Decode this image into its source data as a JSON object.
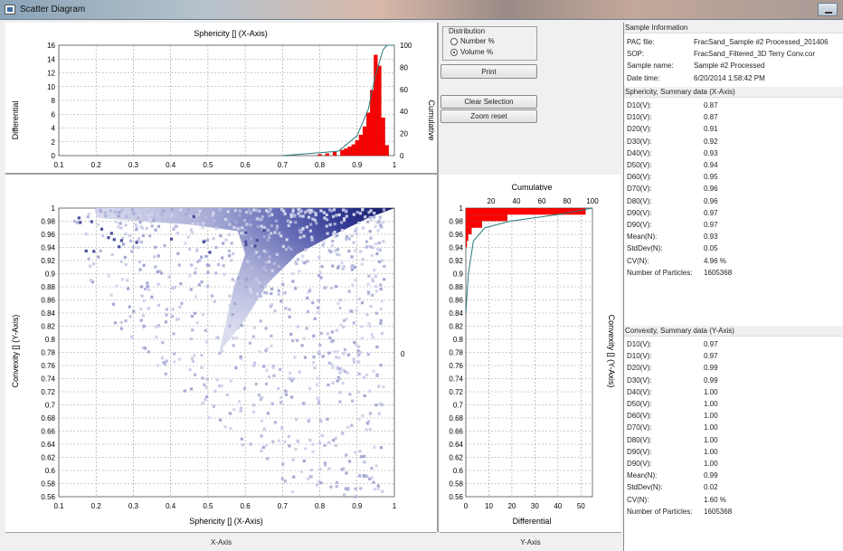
{
  "window": {
    "title": "Scatter Diagram",
    "icon": "app-icon"
  },
  "distribution": {
    "legend": "Distribution",
    "options": [
      "Number %",
      "Volume %"
    ],
    "selected": "Volume %"
  },
  "buttons": {
    "print": "Print",
    "clear_selection": "Clear Selection",
    "zoom_reset": "Zoom reset"
  },
  "footer": {
    "x_axis": "X-Axis",
    "y_axis": "Y-Axis"
  },
  "sample_info": {
    "header": "Sample Information",
    "rows": [
      {
        "k": "PAC file:",
        "v": "FracSand_Sample #2 Processed_201406"
      },
      {
        "k": "SOP:",
        "v": "FracSand_Filtered_3D Terry Conv.cor"
      },
      {
        "k": "Sample name:",
        "v": "Sample #2 Processed"
      },
      {
        "k": "Date time:",
        "v": "6/20/2014 1:58:42 PM"
      }
    ]
  },
  "sphericity_summary": {
    "header": "Sphericity, Summary data (X-Axis)",
    "rows": [
      {
        "k": "D10(V):",
        "v": "0.87"
      },
      {
        "k": "D10(V):",
        "v": "0.87"
      },
      {
        "k": "D20(V):",
        "v": "0.91"
      },
      {
        "k": "D30(V):",
        "v": "0.92"
      },
      {
        "k": "D40(V):",
        "v": "0.93"
      },
      {
        "k": "D50(V):",
        "v": "0.94"
      },
      {
        "k": "D60(V):",
        "v": "0.95"
      },
      {
        "k": "D70(V):",
        "v": "0.96"
      },
      {
        "k": "D80(V):",
        "v": "0.96"
      },
      {
        "k": "D90(V):",
        "v": "0.97"
      },
      {
        "k": "D90(V):",
        "v": "0.97"
      },
      {
        "k": "Mean(N):",
        "v": "0.93"
      },
      {
        "k": "StdDev(N):",
        "v": "0.05"
      },
      {
        "k": "CV(N):",
        "v": "4.96 %"
      },
      {
        "k": "Number of Particles:",
        "v": "1605368"
      }
    ]
  },
  "convexity_summary": {
    "header": "Convexity, Summary data (Y-Axis)",
    "rows": [
      {
        "k": "D10(V):",
        "v": "0.97"
      },
      {
        "k": "D10(V):",
        "v": "0.97"
      },
      {
        "k": "D20(V):",
        "v": "0.99"
      },
      {
        "k": "D30(V):",
        "v": "0.99"
      },
      {
        "k": "D40(V):",
        "v": "1.00"
      },
      {
        "k": "D50(V):",
        "v": "1.00"
      },
      {
        "k": "D60(V):",
        "v": "1.00"
      },
      {
        "k": "D70(V):",
        "v": "1.00"
      },
      {
        "k": "D80(V):",
        "v": "1.00"
      },
      {
        "k": "D90(V):",
        "v": "1.00"
      },
      {
        "k": "D90(V):",
        "v": "1.00"
      },
      {
        "k": "Mean(N):",
        "v": "0.99"
      },
      {
        "k": "StdDev(N):",
        "v": "0.02"
      },
      {
        "k": "CV(N):",
        "v": "1.60 %"
      },
      {
        "k": "Number of Particles:",
        "v": "1605368"
      }
    ]
  },
  "chart_data": [
    {
      "type": "bar",
      "title": "Sphericity [] (X-Axis)",
      "ylabel": "Differential",
      "y2label": "Cumulative",
      "xlim": [
        0.1,
        1
      ],
      "ylim": [
        0,
        16
      ],
      "y2lim": [
        0,
        100
      ],
      "xticks": [
        "0.1",
        "0.2",
        "0.3",
        "0.4",
        "0.5",
        "0.6",
        "0.7",
        "0.8",
        "0.9",
        "1"
      ],
      "yticks": [
        "0",
        "2",
        "4",
        "6",
        "8",
        "10",
        "12",
        "14",
        "16"
      ],
      "y2ticks": [
        "0",
        "20",
        "40",
        "60",
        "80",
        "100"
      ],
      "bar_color": "#ff0000",
      "bins": [
        {
          "x": 0.8,
          "y": 0.2
        },
        {
          "x": 0.82,
          "y": 0.3
        },
        {
          "x": 0.84,
          "y": 0.5
        },
        {
          "x": 0.86,
          "y": 0.8
        },
        {
          "x": 0.87,
          "y": 1.0
        },
        {
          "x": 0.88,
          "y": 1.3
        },
        {
          "x": 0.89,
          "y": 1.6
        },
        {
          "x": 0.9,
          "y": 2.2
        },
        {
          "x": 0.91,
          "y": 3.0
        },
        {
          "x": 0.92,
          "y": 4.2
        },
        {
          "x": 0.93,
          "y": 6.2
        },
        {
          "x": 0.94,
          "y": 9.5
        },
        {
          "x": 0.95,
          "y": 14.6
        },
        {
          "x": 0.96,
          "y": 13.0
        },
        {
          "x": 0.97,
          "y": 5.5
        },
        {
          "x": 0.98,
          "y": 1.5
        }
      ],
      "cumulative": [
        {
          "x": 0.7,
          "y": 0
        },
        {
          "x": 0.85,
          "y": 4
        },
        {
          "x": 0.9,
          "y": 18
        },
        {
          "x": 0.93,
          "y": 42
        },
        {
          "x": 0.95,
          "y": 74
        },
        {
          "x": 0.97,
          "y": 96
        },
        {
          "x": 0.98,
          "y": 100
        },
        {
          "x": 1.0,
          "y": 100
        }
      ]
    },
    {
      "type": "heatmap",
      "xlabel": "Sphericity [] (X-Axis)",
      "ylabel": "Convexity [] (Y-Axis)",
      "xlim": [
        0.1,
        1
      ],
      "ylim": [
        0.56,
        1
      ],
      "xticks": [
        "0.1",
        "0.2",
        "0.3",
        "0.4",
        "0.5",
        "0.6",
        "0.7",
        "0.8",
        "0.9",
        "1"
      ],
      "yticks": [
        "0.56",
        "0.58",
        "0.6",
        "0.62",
        "0.64",
        "0.66",
        "0.68",
        "0.7",
        "0.72",
        "0.74",
        "0.76",
        "0.78",
        "0.8",
        "0.82",
        "0.84",
        "0.86",
        "0.88",
        "0.9",
        "0.92",
        "0.94",
        "0.96",
        "0.98",
        "1"
      ],
      "right_tick": "0",
      "color_low": "#d7d9ee",
      "color_high": "#1a1e6e"
    },
    {
      "type": "bar",
      "orientation": "horizontal",
      "title": "Cumulative",
      "xlabel": "Differential",
      "ylabel": "Convexity [] (Y-Axis)",
      "xlim": [
        0,
        55
      ],
      "ylim": [
        0.56,
        1
      ],
      "x2lim": [
        0,
        100
      ],
      "xticks": [
        "0",
        "10",
        "20",
        "30",
        "40",
        "50"
      ],
      "x2ticks": [
        "20",
        "40",
        "60",
        "80",
        "100"
      ],
      "yticks": [
        "0.56",
        "0.58",
        "0.6",
        "0.62",
        "0.64",
        "0.66",
        "0.68",
        "0.7",
        "0.72",
        "0.74",
        "0.76",
        "0.78",
        "0.8",
        "0.82",
        "0.84",
        "0.86",
        "0.88",
        "0.9",
        "0.92",
        "0.94",
        "0.96",
        "0.98",
        "1"
      ],
      "bar_color": "#ff0000",
      "bins": [
        {
          "y": 0.995,
          "x": 52
        },
        {
          "y": 0.985,
          "x": 18
        },
        {
          "y": 0.975,
          "x": 7
        },
        {
          "y": 0.965,
          "x": 2.5
        },
        {
          "y": 0.955,
          "x": 1
        },
        {
          "y": 0.945,
          "x": 0.4
        }
      ],
      "cumulative": [
        {
          "y": 0.84,
          "x": 0
        },
        {
          "y": 0.9,
          "x": 2
        },
        {
          "y": 0.95,
          "x": 6
        },
        {
          "y": 0.97,
          "x": 15
        },
        {
          "y": 0.98,
          "x": 35
        },
        {
          "y": 0.99,
          "x": 72
        },
        {
          "y": 1.0,
          "x": 100
        }
      ]
    }
  ]
}
